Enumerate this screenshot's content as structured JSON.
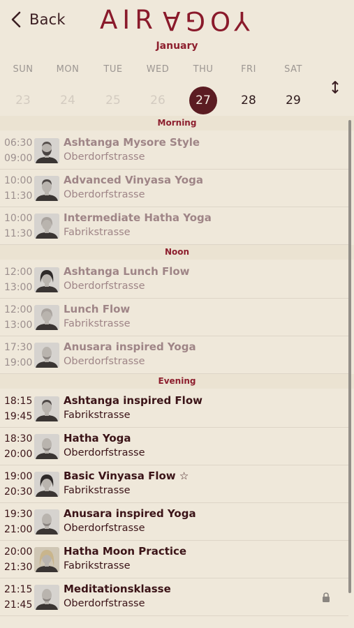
{
  "header": {
    "back_label": "Back",
    "logo_left": "AIR",
    "logo_right": "YOGA"
  },
  "calendar": {
    "month": "January",
    "weekdays": [
      "SUN",
      "MON",
      "TUE",
      "WED",
      "THU",
      "FRI",
      "SAT"
    ],
    "dates": [
      "23",
      "24",
      "25",
      "26",
      "27",
      "28",
      "29"
    ],
    "selected_index": 4
  },
  "sections": [
    {
      "title": "Morning",
      "classes": [
        {
          "start": "06:30",
          "end": "09:00",
          "name": "Ashtanga Mysore Style",
          "location": "Oberdorfstrasse",
          "state": "past",
          "avatar": "avatar-man-beard"
        },
        {
          "start": "10:00",
          "end": "11:30",
          "name": "Advanced Vinyasa Yoga",
          "location": "Oberdorfstrasse",
          "state": "past",
          "avatar": "avatar-man-short-hair"
        },
        {
          "start": "10:00",
          "end": "11:30",
          "name": "Intermediate Hatha Yoga",
          "location": "Fabrikstrasse",
          "state": "past",
          "avatar": "avatar-woman-light"
        }
      ]
    },
    {
      "title": "Noon",
      "classes": [
        {
          "start": "12:00",
          "end": "13:00",
          "name": "Ashtanga Lunch Flow",
          "location": "Oberdorfstrasse",
          "state": "past",
          "avatar": "avatar-woman-dark-hair"
        },
        {
          "start": "12:00",
          "end": "13:00",
          "name": "Lunch Flow",
          "location": "Fabrikstrasse",
          "state": "past",
          "avatar": "avatar-woman-light"
        },
        {
          "start": "17:30",
          "end": "19:00",
          "name": "Anusara inspired Yoga",
          "location": "Oberdorfstrasse",
          "state": "past",
          "avatar": "avatar-man-bald"
        }
      ]
    },
    {
      "title": "Evening",
      "classes": [
        {
          "start": "18:15",
          "end": "19:45",
          "name": "Ashtanga inspired Flow",
          "location": "Fabrikstrasse",
          "state": "upcoming",
          "avatar": "avatar-man-short-hair"
        },
        {
          "start": "18:30",
          "end": "20:00",
          "name": "Hatha Yoga",
          "location": "Oberdorfstrasse",
          "state": "upcoming",
          "avatar": "avatar-man-bald"
        },
        {
          "start": "19:00",
          "end": "20:30",
          "name": "Basic Vinyasa Flow ☆",
          "location": "Fabrikstrasse",
          "state": "upcoming",
          "avatar": "avatar-woman-dark-hair"
        },
        {
          "start": "19:30",
          "end": "21:00",
          "name": "Anusara inspired Yoga",
          "location": "Oberdorfstrasse",
          "state": "upcoming",
          "avatar": "avatar-man-bald"
        },
        {
          "start": "20:00",
          "end": "21:30",
          "name": "Hatha Moon Practice",
          "location": "Fabrikstrasse",
          "state": "upcoming",
          "avatar": "avatar-woman-blonde"
        },
        {
          "start": "21:15",
          "end": "21:45",
          "name": "Meditationsklasse",
          "location": "Oberdorfstrasse",
          "state": "upcoming",
          "avatar": "avatar-man-bald",
          "locked": true
        }
      ]
    }
  ],
  "colors": {
    "accent": "#8d1f2e",
    "selected_date_bg": "#5b1c22",
    "background": "#efe8da",
    "section_bg": "#ebe3d2"
  },
  "icons": {
    "back": "chevron-left-icon",
    "expand": "expand-vertical-icon",
    "lock": "lock-icon"
  }
}
